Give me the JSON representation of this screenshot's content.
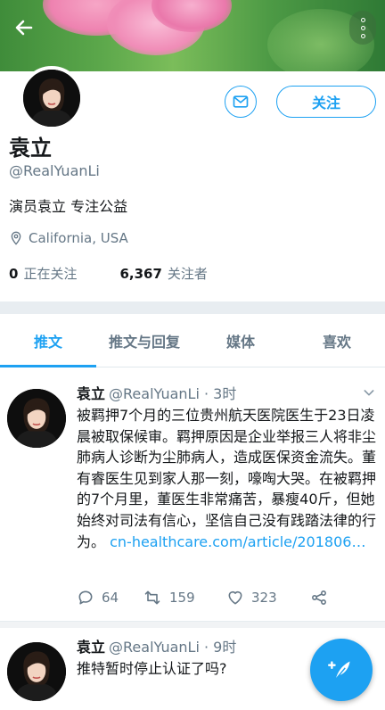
{
  "header": {
    "back_icon": "arrow-left-icon",
    "more_icon": "vertical-dots-icon"
  },
  "profile": {
    "display_name": "袁立",
    "handle": "@RealYuanLi",
    "bio": "演员袁立 专注公益",
    "location": "California, USA",
    "following_count": "0",
    "following_label": "正在关注",
    "followers_count": "6,367",
    "followers_label": "关注者",
    "follow_button": "关注"
  },
  "tabs": [
    "推文",
    "推文与回复",
    "媒体",
    "喜欢"
  ],
  "tweets": [
    {
      "name": "袁立",
      "handle": "@RealYuanLi",
      "time": "· 3时",
      "text": "被羁押7个月的三位贵州航天医院医生于23日凌晨被取保候审。羁押原因是企业举报三人将非尘肺病人诊断为尘肺病人，造成医保资金流失。董有睿医生见到家人那一刻，嚎啕大哭。在被羁押的7个月里，董医生非常痛苦，暴瘦40斤，但她始终对司法有信心，坚信自己没有践踏法律的行为。",
      "link": "cn-healthcare.com/article/201806…",
      "replies": "64",
      "retweets": "159",
      "likes": "323"
    },
    {
      "name": "袁立",
      "handle": "@RealYuanLi",
      "time": "· 9时",
      "text": "推特暂时停止认证了吗?"
    }
  ],
  "colors": {
    "accent": "#1da1f2",
    "muted": "#657786",
    "text": "#14171a"
  }
}
